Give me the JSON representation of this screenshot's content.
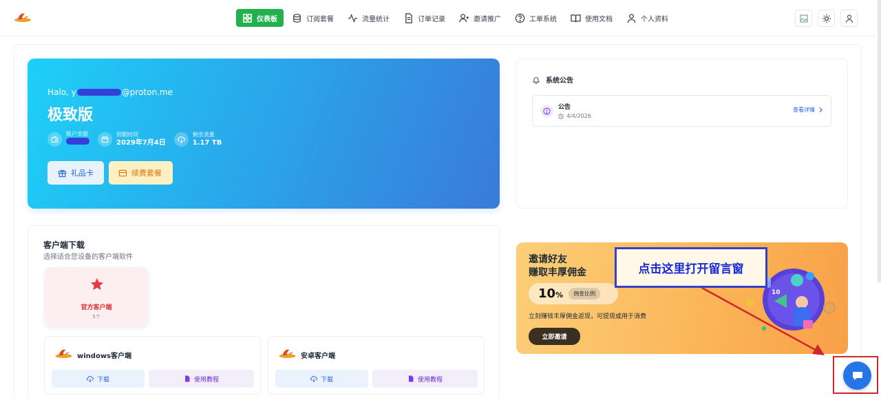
{
  "nav": {
    "items": [
      {
        "label": "仪表板",
        "icon": "dashboard-icon",
        "active": true
      },
      {
        "label": "订阅套餐",
        "icon": "database-icon",
        "active": false
      },
      {
        "label": "流量统计",
        "icon": "activity-icon",
        "active": false
      },
      {
        "label": "订单记录",
        "icon": "document-icon",
        "active": false
      },
      {
        "label": "邀请推广",
        "icon": "user-plus-icon",
        "active": false
      },
      {
        "label": "工单系统",
        "icon": "help-circle-icon",
        "active": false
      },
      {
        "label": "使用文档",
        "icon": "book-icon",
        "active": false
      },
      {
        "label": "个人资料",
        "icon": "user-icon",
        "active": false
      }
    ]
  },
  "hero": {
    "greeting_prefix": "Halo, y",
    "greeting_suffix": "@proton.me",
    "plan": "极致版",
    "stats": [
      {
        "label": "账户余额",
        "value": ""
      },
      {
        "label": "到期时间",
        "value": "2029年7月4日"
      },
      {
        "label": "剩余流量",
        "value": "1.17 TB"
      }
    ],
    "gift_label": "礼品卡",
    "renew_label": "续费套餐"
  },
  "announcement": {
    "title": "系统公告",
    "item_name": "公告",
    "item_date": "4/4/2026",
    "detail_link": "查看详情"
  },
  "clients": {
    "title": "客户端下载",
    "subtitle": "选择适合您设备的客户端软件",
    "official_name": "官方客户端",
    "official_count": "5个",
    "cards": [
      {
        "name": "windows客户端",
        "download": "下载",
        "tutorial": "使用教程"
      },
      {
        "name": "安卓客户端",
        "download": "下载",
        "tutorial": "使用教程"
      }
    ]
  },
  "invite": {
    "title_line1": "邀请好友",
    "title_line2": "赚取丰厚佣金",
    "rate": "10",
    "rate_unit": "%",
    "rate_tag": "佣金比例",
    "description": "立刻赚钱丰厚佣金返现，可提现或用于消费",
    "button": "立即邀请"
  },
  "annotation": {
    "callout": "点击这里打开留言窗"
  },
  "colors": {
    "nav_active": "#22b14c",
    "callout_border": "#3440c8",
    "arrow": "#d0262d",
    "chat_button": "#2575e6"
  }
}
